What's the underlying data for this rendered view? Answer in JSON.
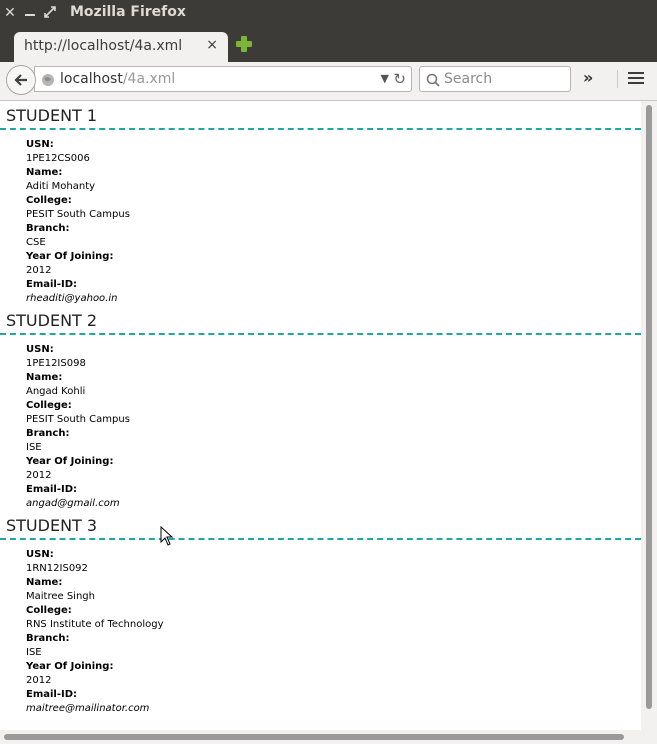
{
  "window": {
    "title": "Mozilla Firefox"
  },
  "tab": {
    "label": "http://localhost/4a.xml",
    "close": "×"
  },
  "navbar": {
    "url_host": "localhost",
    "url_path": "/4a.xml",
    "search_placeholder": "Search",
    "overflow": "»"
  },
  "students": [
    {
      "heading": "STUDENT 1",
      "fields": [
        {
          "label": "USN:",
          "value": "1PE12CS006"
        },
        {
          "label": "Name:",
          "value": "Aditi Mohanty"
        },
        {
          "label": "College:",
          "value": "PESIT South Campus"
        },
        {
          "label": "Branch:",
          "value": "CSE"
        },
        {
          "label": "Year Of Joining:",
          "value": "2012"
        },
        {
          "label": "Email-ID:",
          "value": "rheaditi@yahoo.in"
        }
      ]
    },
    {
      "heading": "STUDENT 2",
      "fields": [
        {
          "label": "USN:",
          "value": "1PE12IS098"
        },
        {
          "label": "Name:",
          "value": "Angad Kohli"
        },
        {
          "label": "College:",
          "value": "PESIT South Campus"
        },
        {
          "label": "Branch:",
          "value": "ISE"
        },
        {
          "label": "Year Of Joining:",
          "value": "2012"
        },
        {
          "label": "Email-ID:",
          "value": "angad@gmail.com"
        }
      ]
    },
    {
      "heading": "STUDENT 3",
      "fields": [
        {
          "label": "USN:",
          "value": "1RN12IS092"
        },
        {
          "label": "Name:",
          "value": "Maitree Singh"
        },
        {
          "label": "College:",
          "value": "RNS Institute of Technology"
        },
        {
          "label": "Branch:",
          "value": "ISE"
        },
        {
          "label": "Year Of Joining:",
          "value": "2012"
        },
        {
          "label": "Email-ID:",
          "value": "maitree@mailinator.com"
        }
      ]
    }
  ],
  "colors": {
    "divider": "#1ea7a3",
    "titlebar": "#3c3b37",
    "newtab": "#7ab536"
  },
  "icons": [
    "close-icon",
    "minimize-icon",
    "maximize-icon",
    "new-tab-icon",
    "back-arrow-icon",
    "globe-icon",
    "dropdown-icon",
    "reload-icon",
    "search-icon",
    "overflow-icon",
    "menu-icon"
  ]
}
